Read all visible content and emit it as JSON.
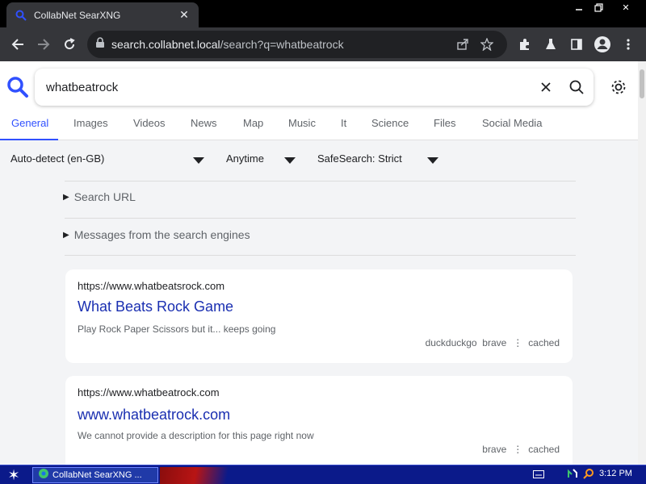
{
  "browser": {
    "tab_title": "CollabNet SearXNG",
    "url_host": "search.collabnet.local",
    "url_path": "/search?q=whatbeatrock"
  },
  "search": {
    "query": "whatbeatrock"
  },
  "categories": [
    "General",
    "Images",
    "Videos",
    "News",
    "Map",
    "Music",
    "It",
    "Science",
    "Files",
    "Social Media"
  ],
  "active_category": "General",
  "filters": {
    "language": "Auto-detect (en-GB)",
    "time_range": "Anytime",
    "safesearch": "SafeSearch: Strict"
  },
  "sections": {
    "search_url": "Search URL",
    "engine_messages": "Messages from the search engines"
  },
  "results": [
    {
      "url": "https://www.whatbeatsrock.com",
      "title": "What Beats Rock Game",
      "description": "Play Rock Paper Scissors but it... keeps going",
      "engines": "duckduckgo  brave",
      "cached": "cached"
    },
    {
      "url": "https://www.whatbeatrock.com",
      "title": "www.whatbeatrock.com",
      "description": "We cannot provide a description for this page right now",
      "engines": "brave",
      "cached": "cached"
    }
  ],
  "taskbar": {
    "task_label": "CollabNet SearXNG ...",
    "clock": "3:12 PM"
  },
  "colors": {
    "accent": "#3050ff",
    "result_title": "#1a2fb1",
    "chrome_dark": "#35363a",
    "taskbar": "#0b1a8a"
  }
}
